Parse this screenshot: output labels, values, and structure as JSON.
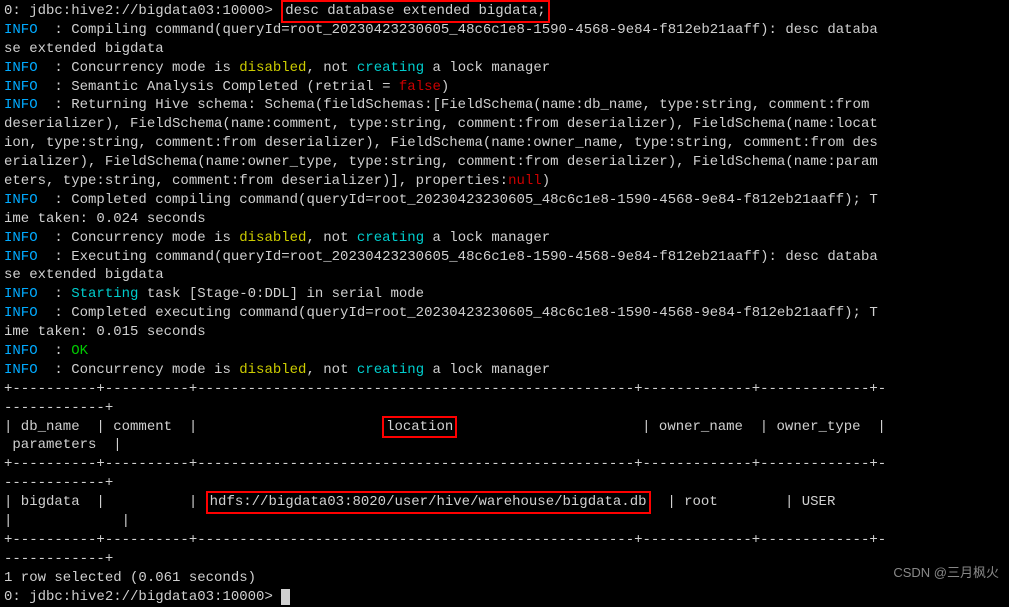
{
  "prompt_prefix": "0: jdbc:hive2://bigdata03:10000> ",
  "command": "desc database extended bigdata;",
  "log_lines": [
    {
      "prefix": "INFO",
      "rest": "  : Compiling command(queryId=root_20230423230605_48c6c1e8-1590-4568-9e84-f812eb21aaff): desc databa"
    },
    {
      "prefix": "",
      "rest": "se extended bigdata"
    },
    {
      "prefix": "INFO",
      "rest": "  : Concurrency mode is ",
      "yellow1": "disabled",
      "mid1": ", not ",
      "cyan1": "creating",
      "tail1": " a lock manager"
    },
    {
      "prefix": "INFO",
      "rest": "  : Semantic Analysis Completed (retrial = ",
      "red1": "false",
      "tail1": ")"
    },
    {
      "prefix": "INFO",
      "rest": "  : Returning Hive schema: Schema(fieldSchemas:[FieldSchema(name:db_name, type:string, comment:from "
    },
    {
      "prefix": "",
      "rest": "deserializer), FieldSchema(name:comment, type:string, comment:from deserializer), FieldSchema(name:locat"
    },
    {
      "prefix": "",
      "rest": "ion, type:string, comment:from deserializer), FieldSchema(name:owner_name, type:string, comment:from des"
    },
    {
      "prefix": "",
      "rest": "erializer), FieldSchema(name:owner_type, type:string, comment:from deserializer), FieldSchema(name:param"
    },
    {
      "prefix": "",
      "rest": "eters, type:string, comment:from deserializer)], properties:",
      "red1": "null",
      "tail1": ")"
    },
    {
      "prefix": "INFO",
      "rest": "  : Completed compiling command(queryId=root_20230423230605_48c6c1e8-1590-4568-9e84-f812eb21aaff); T"
    },
    {
      "prefix": "",
      "rest": "ime taken: 0.024 seconds"
    },
    {
      "prefix": "INFO",
      "rest": "  : Concurrency mode is ",
      "yellow1": "disabled",
      "mid1": ", not ",
      "cyan1": "creating",
      "tail1": " a lock manager"
    },
    {
      "prefix": "INFO",
      "rest": "  : Executing command(queryId=root_20230423230605_48c6c1e8-1590-4568-9e84-f812eb21aaff): desc databa"
    },
    {
      "prefix": "",
      "rest": "se extended bigdata"
    },
    {
      "prefix": "INFO",
      "rest": "  : ",
      "cyan1": "Starting",
      "tail1": " task [Stage-0:DDL] in serial mode"
    },
    {
      "prefix": "INFO",
      "rest": "  : Completed executing command(queryId=root_20230423230605_48c6c1e8-1590-4568-9e84-f812eb21aaff); T"
    },
    {
      "prefix": "",
      "rest": "ime taken: 0.015 seconds"
    },
    {
      "prefix": "INFO",
      "rest": "  : ",
      "green1": "OK"
    },
    {
      "prefix": "INFO",
      "rest": "  : Concurrency mode is ",
      "yellow1": "disabled",
      "mid1": ", not ",
      "cyan1": "creating",
      "tail1": " a lock manager"
    }
  ],
  "table_sep1": "+----------+----------+----------------------------------------------------+-------------+-------------+-",
  "table_sep2": "------------+",
  "header_row1_a": "| db_name  | comment  |                      ",
  "header_location": "location",
  "header_row1_b": "                      | owner_name  | owner_type  |",
  "header_row2": " parameters  |",
  "data_row1_a": "| bigdata  |          | ",
  "data_location": "hdfs://bigdata03:8020/user/hive/warehouse/bigdata.db",
  "data_row1_b": "  | root        | USER        ",
  "data_row2": "|             |",
  "result_text": "1 row selected (0.061 seconds)",
  "watermark": "CSDN @三月枫火"
}
